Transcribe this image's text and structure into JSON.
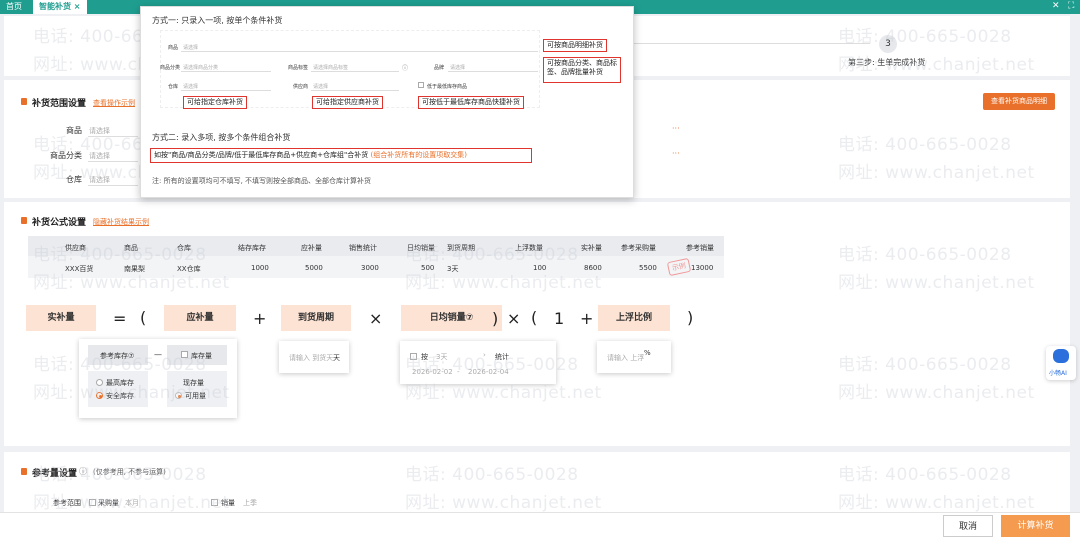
{
  "topbar": {
    "home_tab": "首页",
    "active_tab": "智能补货",
    "close": "×"
  },
  "watermark": {
    "phone": "电话: 400-665-0028",
    "site": "网址: www.chanjet.net"
  },
  "steps": {
    "step3_num": "3",
    "step3_label": "第三步: 生单完成补货"
  },
  "scope": {
    "title": "补货范围设置",
    "link": "查看操作示例",
    "view_btn": "查看补货商品明细",
    "rows": [
      {
        "label": "商品",
        "placeholder": "请选择"
      },
      {
        "label": "商品分类",
        "placeholder": "请选择"
      },
      {
        "label": "仓库",
        "placeholder": "请选择"
      }
    ]
  },
  "popup": {
    "way1": "方式一: 只录入一项, 按单个条件补货",
    "row1": {
      "label": "商品",
      "placeholder": "请选择"
    },
    "row2": [
      {
        "label": "商品分类",
        "placeholder": "请选择商品分类"
      },
      {
        "label": "商品标签",
        "placeholder": "请选择商品标签"
      },
      {
        "label": "品牌",
        "placeholder": "请选择"
      }
    ],
    "row3": [
      {
        "label": "仓库",
        "placeholder": "请选择"
      },
      {
        "label": "供应商",
        "placeholder": "请选择"
      }
    ],
    "low_stock": "低于最低库存商品",
    "ann_detail": "可按商品明细补货",
    "ann_category": "可按商品分类、商品标签、品牌批量补货",
    "ann_warehouse": "可给指定仓库补货",
    "ann_supplier": "可给指定供应商补货",
    "ann_low": "可按低于最低库存商品快捷补货",
    "way2": "方式二: 录入多项, 按多个条件组合补货",
    "combo": "如按\"商品/商品分类/品牌/低于最低库存商品+供应商+仓库组\"合补货",
    "combo_note": "(组合补货所有的设置项取交集)",
    "note": "注: 所有的设置项均可不填写, 不填写则按全部商品、全部仓库计算补货"
  },
  "formula": {
    "title": "补货公式设置",
    "link": "隐藏补货结果示例",
    "columns": [
      "供应商",
      "商品",
      "仓库",
      "结存库存",
      "应补量",
      "销售统计",
      "日均销量",
      "到货周期",
      "上浮数量",
      "实补量",
      "参考采购量",
      "参考销量"
    ],
    "row": [
      "XXX百货",
      "南果梨",
      "XX仓库",
      "1000",
      "5000",
      "3000",
      "500",
      "3天",
      "100",
      "8600",
      "5500",
      "13000"
    ],
    "stamp": "示例",
    "terms": {
      "actual": "实补量",
      "eq": "=",
      "lp": "(",
      "should": "应补量",
      "plus": "+",
      "cycle": "到货周期",
      "times": "×",
      "daily": "日均销量⑦",
      "rp": ")",
      "times2": "×",
      "lp2": "(",
      "one": "1",
      "plus2": "+",
      "float": "上浮比例",
      "rp2": ")"
    },
    "ref_stock": "参考库存⑦",
    "minus": "—",
    "stock_qty": "库存量",
    "max_stock": "最高库存",
    "safe_stock": "安全库存",
    "current": "现存量",
    "available": "可用量",
    "cycle_ph": "请输入 到货天",
    "cycle_unit": "天",
    "daily_by": "按",
    "daily_days": "3天",
    "daily_stat": "统计",
    "date_from": "2026-02-02",
    "date_sep": "-",
    "date_to": "2026-02-04",
    "float_ph": "请输入 上浮",
    "float_unit": "%"
  },
  "reference": {
    "title": "参考量设置",
    "hint": "(仅参考用, 不参与运算)",
    "scope_label": "参考范围",
    "purchase": "采购量",
    "purchase_period": "本月",
    "sales": "销量",
    "sales_period": "上季"
  },
  "assistant": "小畅AI",
  "footer": {
    "cancel": "取消",
    "calc": "计算补货"
  },
  "colors": {
    "teal": "#1f9e90",
    "accent": "#e8702a",
    "annotation": "#e0342e"
  }
}
